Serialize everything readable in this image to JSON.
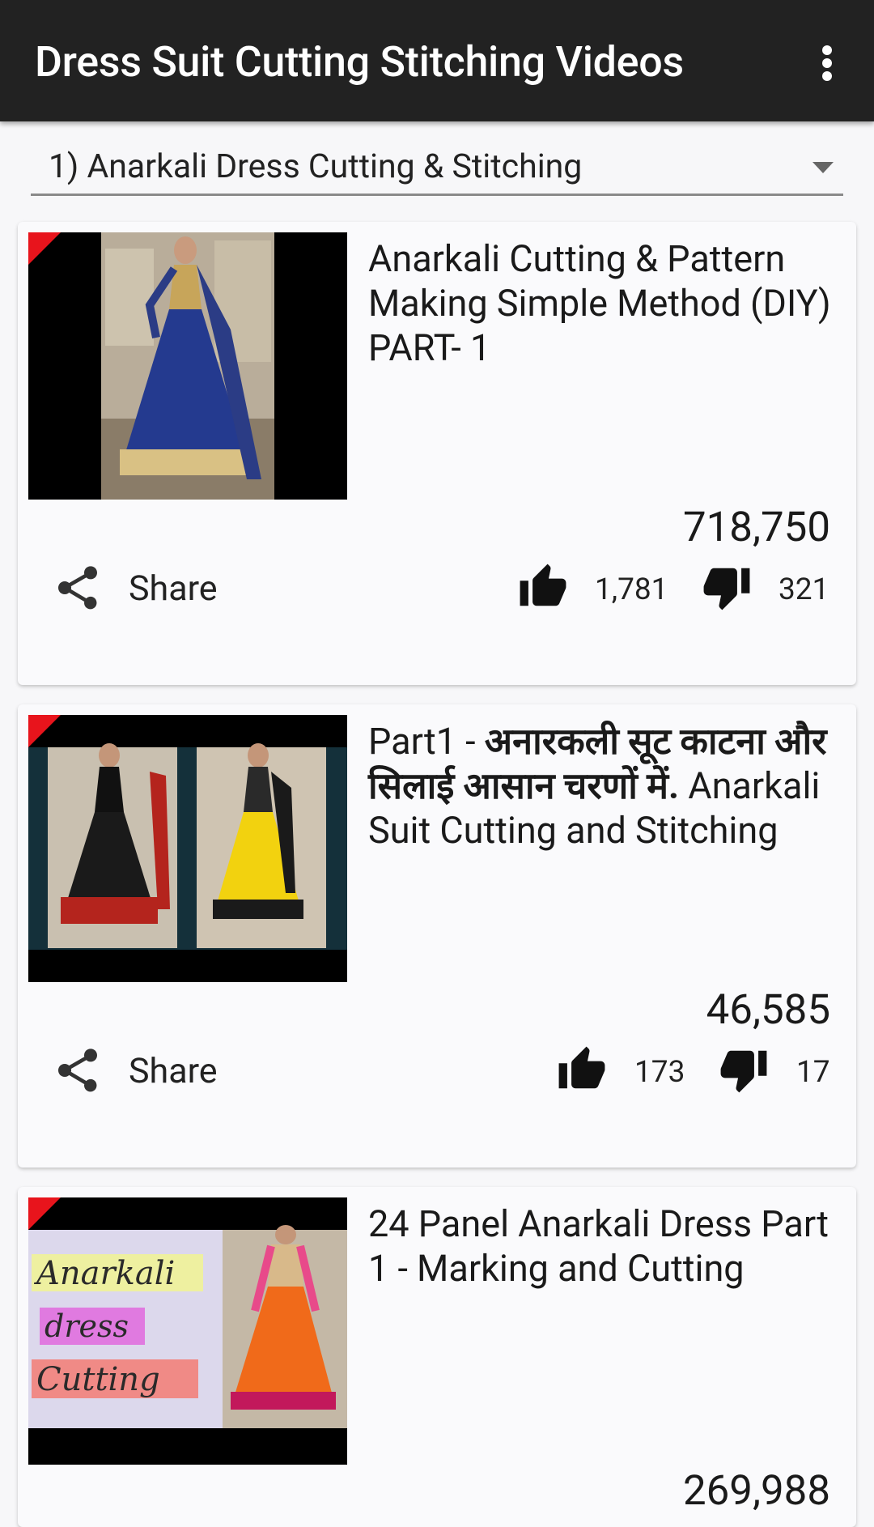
{
  "app": {
    "title": "Dress Suit Cutting Stitching Videos",
    "menu_icon": "overflow-menu-icon"
  },
  "spinner": {
    "selected": "1) Anarkali Dress Cutting & Stitching"
  },
  "colors": {
    "appbar": "#222222",
    "accent_red": "#e8141c",
    "background": "#f7f7f9"
  },
  "videos": [
    {
      "title": "Anarkali Cutting & Pattern Making Simple Method (DIY) PART- 1",
      "views": "718,750",
      "share_label": "Share",
      "likes": "1,781",
      "dislikes": "321"
    },
    {
      "title_prefix": "Part1 - ",
      "title_hindi": "अनारकली सूट काटना और सिलाई आसान चरणों में.",
      "title_suffix": " Anarkali Suit Cutting and Stitching",
      "views": "46,585",
      "share_label": "Share",
      "likes": "173",
      "dislikes": "17"
    },
    {
      "title": "24 Panel Anarkali Dress Part 1 - Marking and Cutting",
      "views": "269,988",
      "thumb_text": [
        "Anarkali",
        "dress",
        "Cutting"
      ]
    }
  ]
}
